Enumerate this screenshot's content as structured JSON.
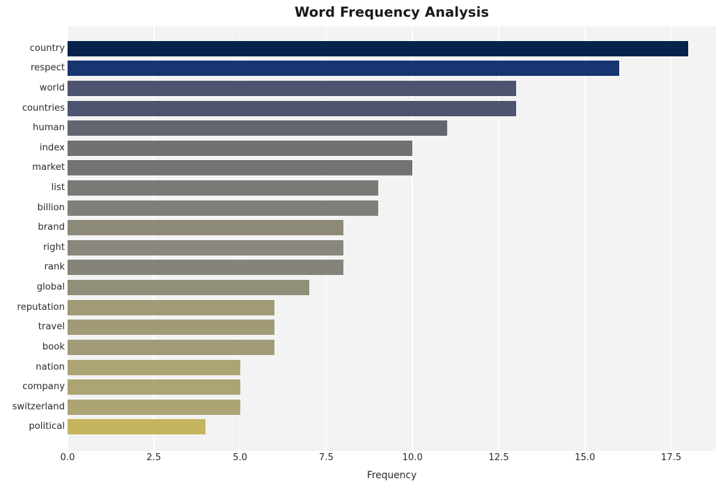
{
  "chart_data": {
    "type": "bar",
    "orientation": "horizontal",
    "title": "Word Frequency Analysis",
    "xlabel": "Frequency",
    "ylabel": "",
    "categories": [
      "country",
      "respect",
      "world",
      "countries",
      "human",
      "index",
      "market",
      "list",
      "billion",
      "brand",
      "right",
      "rank",
      "global",
      "reputation",
      "travel",
      "book",
      "nation",
      "company",
      "switzerland",
      "political"
    ],
    "values": [
      18,
      16,
      13,
      13,
      11,
      10,
      10,
      9,
      9,
      8,
      8,
      8,
      7,
      6,
      6,
      6,
      5,
      5,
      5,
      4
    ],
    "bar_colors": [
      "#05234c",
      "#173571",
      "#4e5470",
      "#4e5470",
      "#63656f",
      "#717173",
      "#737373",
      "#7b7a76",
      "#807e78",
      "#8d8a7a",
      "#89877b",
      "#85837a",
      "#918e79",
      "#a09a77",
      "#a09a77",
      "#a09a77",
      "#ada473",
      "#ada473",
      "#ada473",
      "#c4b45e"
    ],
    "xticks": [
      0.0,
      2.5,
      5.0,
      7.5,
      10.0,
      12.5,
      15.0,
      17.5
    ],
    "xtick_labels": [
      "0.0",
      "2.5",
      "5.0",
      "7.5",
      "10.0",
      "12.5",
      "15.0",
      "17.5"
    ],
    "xlim": [
      0,
      18.8
    ],
    "grid": "vertical-white",
    "plot_background": "#f3f3f4",
    "figure_background": "#ffffff",
    "legend": null
  }
}
